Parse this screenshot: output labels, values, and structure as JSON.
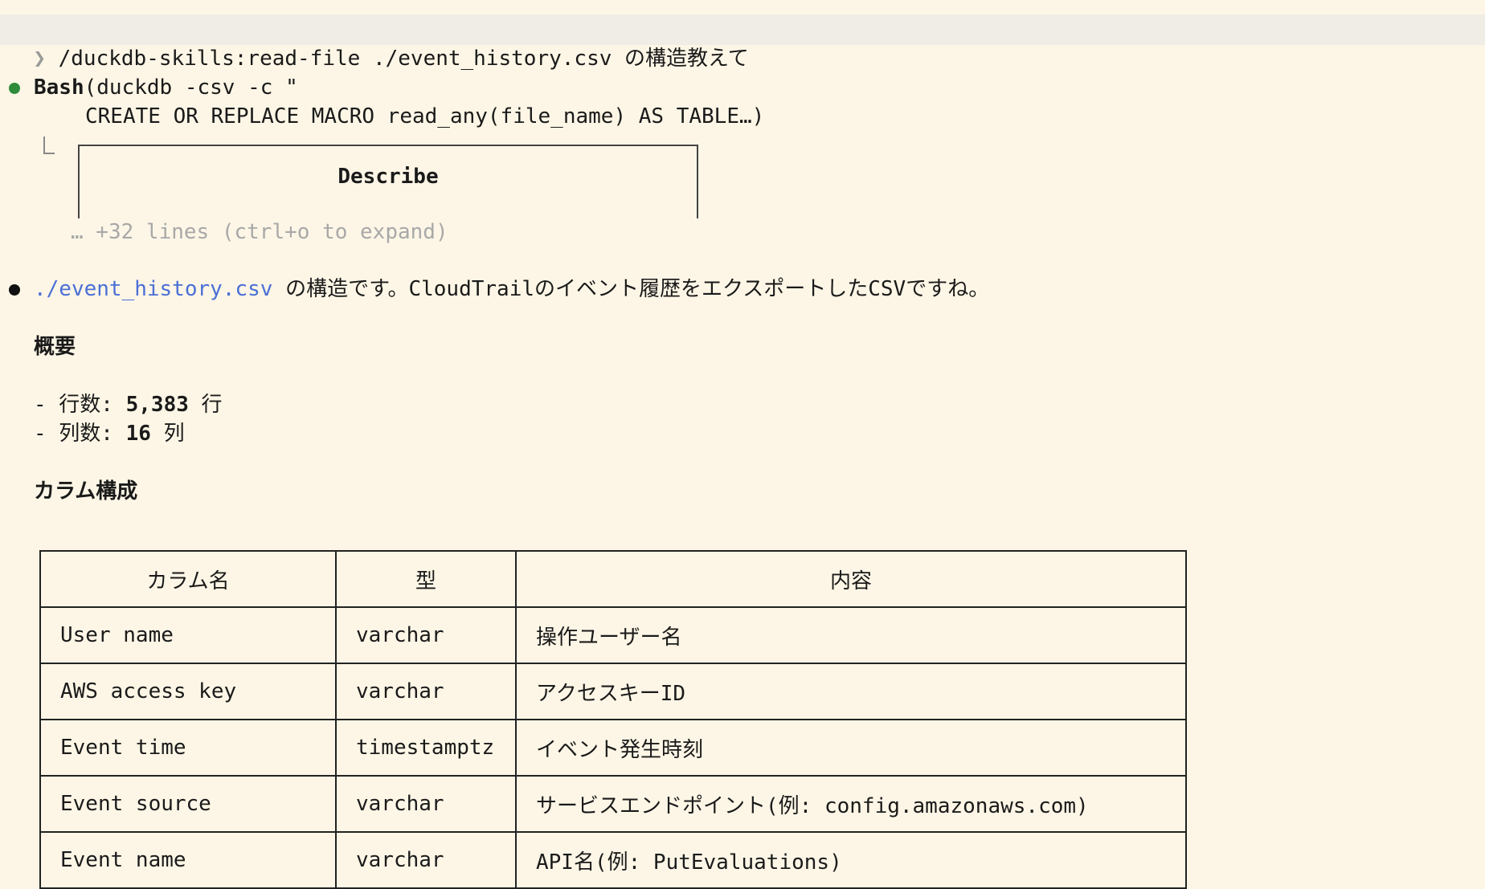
{
  "prompt": {
    "chevron": "❯",
    "command": "/duckdb-skills:read-file ./event_history.csv の構造教えて"
  },
  "tool_call": {
    "name": "Bash",
    "args_line1": "(duckdb -csv -c \"",
    "args_line2": "CREATE OR REPLACE MACRO read_any(file_name) AS TABLE…)",
    "box_title": "Describe",
    "expand_hint": "… +32 lines (ctrl+o to expand)"
  },
  "response": {
    "file_link": "./event_history.csv",
    "intro_rest": " の構造です。CloudTrailのイベント履歴をエクスポートしたCSVですね。",
    "overview_heading": "概要",
    "rows_prefix": "- 行数: ",
    "rows_value": "5,383",
    "rows_suffix": " 行",
    "cols_prefix": "- 列数: ",
    "cols_value": "16",
    "cols_suffix": " 列",
    "columns_heading": "カラム構成"
  },
  "table": {
    "headers": [
      "カラム名",
      "型",
      "内容"
    ],
    "rows": [
      [
        "User name",
        "varchar",
        "操作ユーザー名"
      ],
      [
        "AWS access key",
        "varchar",
        "アクセスキーID"
      ],
      [
        "Event time",
        "timestamptz",
        "イベント発生時刻"
      ],
      [
        "Event source",
        "varchar",
        "サービスエンドポイント(例: config.amazonaws.com)"
      ],
      [
        "Event name",
        "varchar",
        "API名(例: PutEvaluations)"
      ]
    ]
  }
}
